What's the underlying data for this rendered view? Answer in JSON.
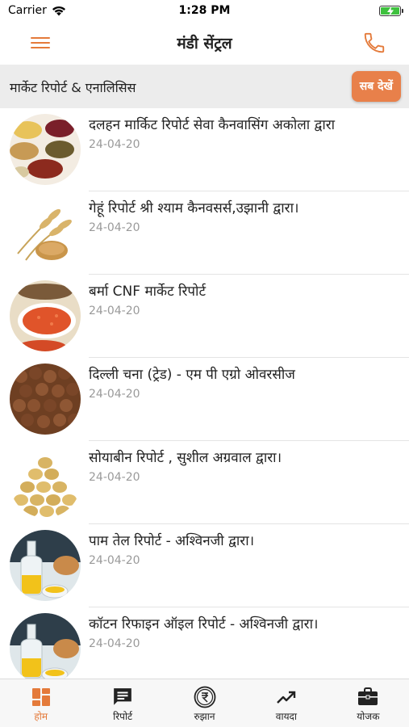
{
  "status_bar": {
    "carrier": "Carrier",
    "time": "1:28 PM"
  },
  "nav": {
    "title": "मंडी सेंट्रल"
  },
  "section": {
    "title": "मार्केट रिपोर्ट & एनालिसिस",
    "see_all_label": "सब देखें"
  },
  "reports": [
    {
      "title": "दलहन मार्किट रिपोर्ट सेवा कैनवासिंग अकोला द्वारा",
      "date": "24-04-20",
      "image": "pulses-bowls-image"
    },
    {
      "title": "गेहूं रिपोर्ट श्री श्याम कैनवसर्स,उझानी द्वारा।",
      "date": "24-04-20",
      "image": "wheat-image"
    },
    {
      "title": "बर्मा CNF मार्केट रिपोर्ट",
      "date": "24-04-20",
      "image": "red-lentils-image"
    },
    {
      "title": "दिल्ली चना (ट्रेड) - एम पी एग्रो ओवरसीज",
      "date": "24-04-20",
      "image": "chickpeas-image"
    },
    {
      "title": "सोयाबीन रिपोर्ट , सुशील अग्रवाल द्वारा।",
      "date": "24-04-20",
      "image": "soybean-image"
    },
    {
      "title": "पाम तेल रिपोर्ट - अश्विनजी द्वारा।",
      "date": "24-04-20",
      "image": "oil-bottle-image"
    },
    {
      "title": "कॉटन रिफाइन ऑइल रिपोर्ट - अश्विनजी द्वारा।",
      "date": "24-04-20",
      "image": "oil-bottle-image"
    }
  ],
  "tabs": [
    {
      "label": "होम",
      "icon": "home-grid-icon",
      "active": true
    },
    {
      "label": "रिपोर्ट",
      "icon": "report-chat-icon",
      "active": false
    },
    {
      "label": "रुझान",
      "icon": "rupee-coin-icon",
      "active": false
    },
    {
      "label": "वायदा",
      "icon": "trend-up-icon",
      "active": false
    },
    {
      "label": "योजक",
      "icon": "briefcase-icon",
      "active": false
    }
  ],
  "colors": {
    "accent": "#e47a3a",
    "button": "#e8804a",
    "section_bg": "#ececec",
    "date_text": "#9a9a9a"
  }
}
